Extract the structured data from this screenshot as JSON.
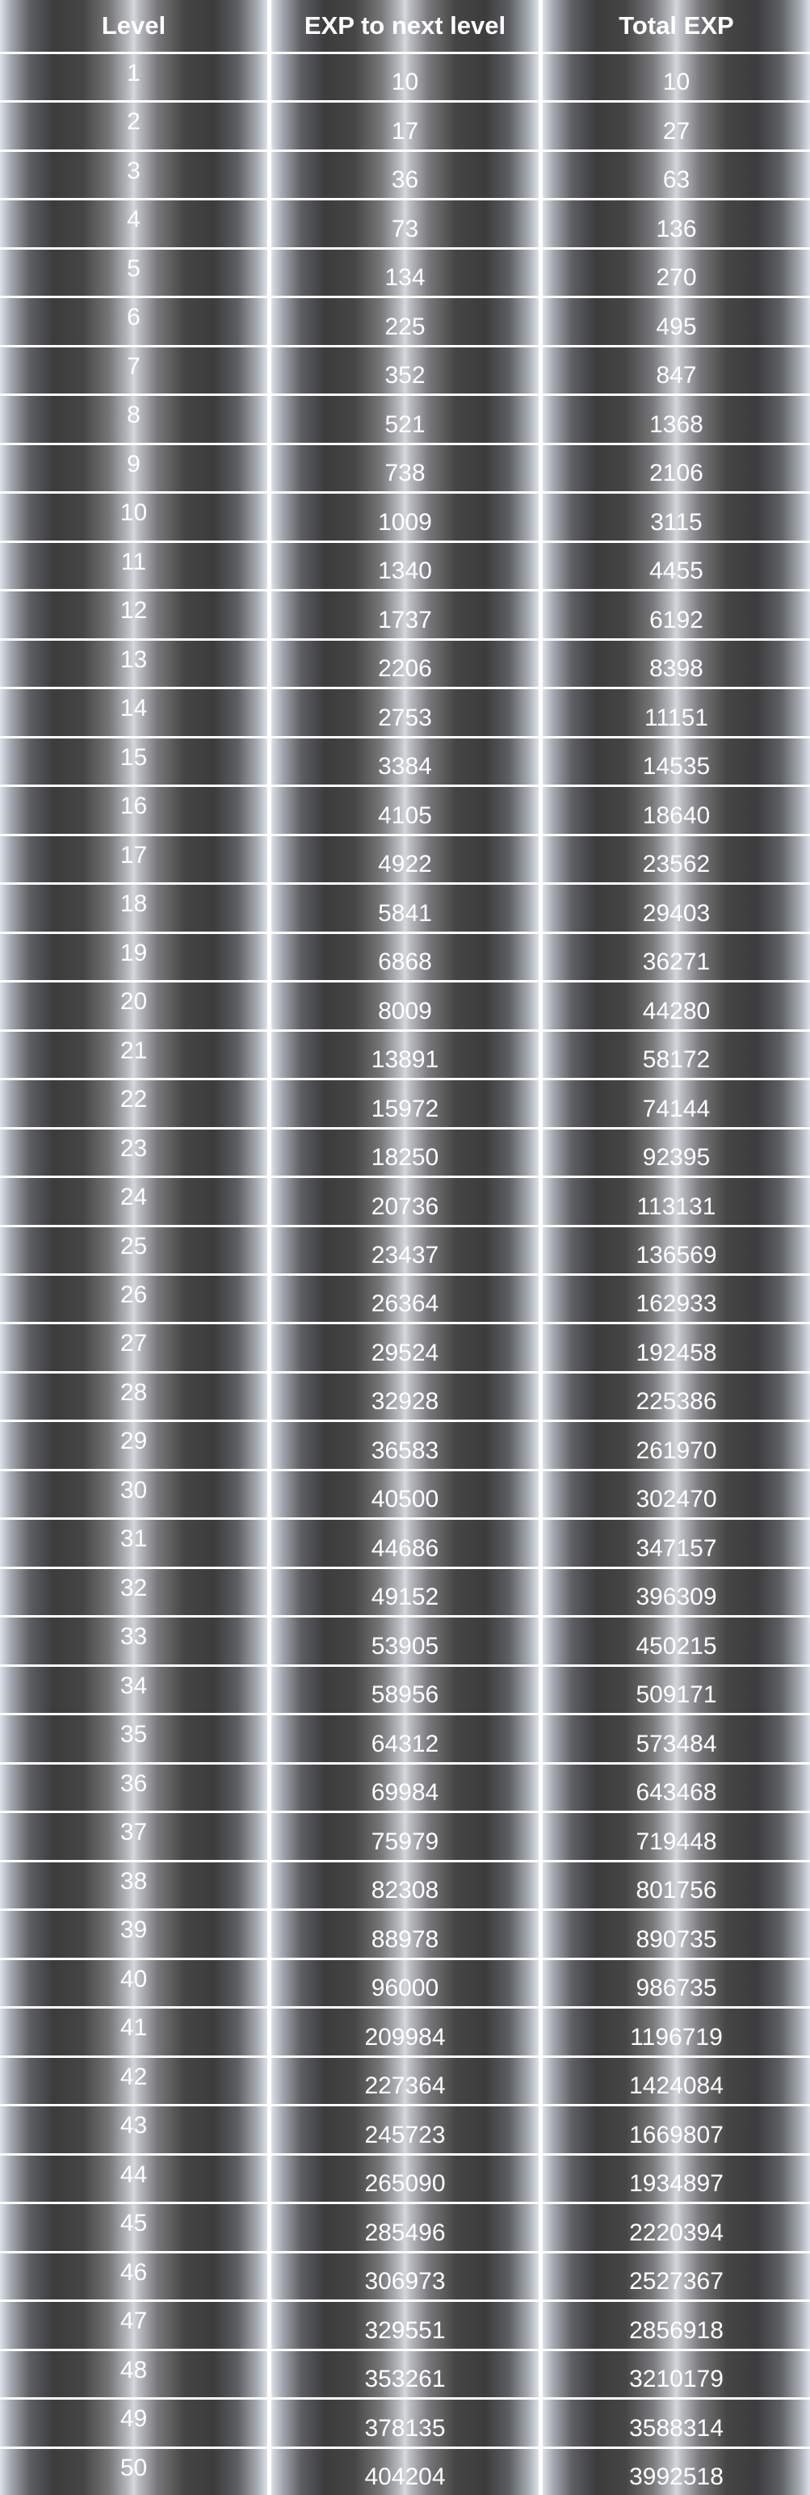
{
  "table": {
    "headers": [
      "Level",
      "EXP to next level",
      "Total EXP"
    ],
    "rows": [
      {
        "level": "1",
        "exp_to_next": "10",
        "total_exp": "10"
      },
      {
        "level": "2",
        "exp_to_next": "17",
        "total_exp": "27"
      },
      {
        "level": "3",
        "exp_to_next": "36",
        "total_exp": "63"
      },
      {
        "level": "4",
        "exp_to_next": "73",
        "total_exp": "136"
      },
      {
        "level": "5",
        "exp_to_next": "134",
        "total_exp": "270"
      },
      {
        "level": "6",
        "exp_to_next": "225",
        "total_exp": "495"
      },
      {
        "level": "7",
        "exp_to_next": "352",
        "total_exp": "847"
      },
      {
        "level": "8",
        "exp_to_next": "521",
        "total_exp": "1368"
      },
      {
        "level": "9",
        "exp_to_next": "738",
        "total_exp": "2106"
      },
      {
        "level": "10",
        "exp_to_next": "1009",
        "total_exp": "3115"
      },
      {
        "level": "11",
        "exp_to_next": "1340",
        "total_exp": "4455"
      },
      {
        "level": "12",
        "exp_to_next": "1737",
        "total_exp": "6192"
      },
      {
        "level": "13",
        "exp_to_next": "2206",
        "total_exp": "8398"
      },
      {
        "level": "14",
        "exp_to_next": "2753",
        "total_exp": "11151"
      },
      {
        "level": "15",
        "exp_to_next": "3384",
        "total_exp": "14535"
      },
      {
        "level": "16",
        "exp_to_next": "4105",
        "total_exp": "18640"
      },
      {
        "level": "17",
        "exp_to_next": "4922",
        "total_exp": "23562"
      },
      {
        "level": "18",
        "exp_to_next": "5841",
        "total_exp": "29403"
      },
      {
        "level": "19",
        "exp_to_next": "6868",
        "total_exp": "36271"
      },
      {
        "level": "20",
        "exp_to_next": "8009",
        "total_exp": "44280"
      },
      {
        "level": "21",
        "exp_to_next": "13891",
        "total_exp": "58172"
      },
      {
        "level": "22",
        "exp_to_next": "15972",
        "total_exp": "74144"
      },
      {
        "level": "23",
        "exp_to_next": "18250",
        "total_exp": "92395"
      },
      {
        "level": "24",
        "exp_to_next": "20736",
        "total_exp": "113131"
      },
      {
        "level": "25",
        "exp_to_next": "23437",
        "total_exp": "136569"
      },
      {
        "level": "26",
        "exp_to_next": "26364",
        "total_exp": "162933"
      },
      {
        "level": "27",
        "exp_to_next": "29524",
        "total_exp": "192458"
      },
      {
        "level": "28",
        "exp_to_next": "32928",
        "total_exp": "225386"
      },
      {
        "level": "29",
        "exp_to_next": "36583",
        "total_exp": "261970"
      },
      {
        "level": "30",
        "exp_to_next": "40500",
        "total_exp": "302470"
      },
      {
        "level": "31",
        "exp_to_next": "44686",
        "total_exp": "347157"
      },
      {
        "level": "32",
        "exp_to_next": "49152",
        "total_exp": "396309"
      },
      {
        "level": "33",
        "exp_to_next": "53905",
        "total_exp": "450215"
      },
      {
        "level": "34",
        "exp_to_next": "58956",
        "total_exp": "509171"
      },
      {
        "level": "35",
        "exp_to_next": "64312",
        "total_exp": "573484"
      },
      {
        "level": "36",
        "exp_to_next": "69984",
        "total_exp": "643468"
      },
      {
        "level": "37",
        "exp_to_next": "75979",
        "total_exp": "719448"
      },
      {
        "level": "38",
        "exp_to_next": "82308",
        "total_exp": "801756"
      },
      {
        "level": "39",
        "exp_to_next": "88978",
        "total_exp": "890735"
      },
      {
        "level": "40",
        "exp_to_next": "96000",
        "total_exp": "986735"
      },
      {
        "level": "41",
        "exp_to_next": "209984",
        "total_exp": "1196719"
      },
      {
        "level": "42",
        "exp_to_next": "227364",
        "total_exp": "1424084"
      },
      {
        "level": "43",
        "exp_to_next": "245723",
        "total_exp": "1669807"
      },
      {
        "level": "44",
        "exp_to_next": "265090",
        "total_exp": "1934897"
      },
      {
        "level": "45",
        "exp_to_next": "285496",
        "total_exp": "2220394"
      },
      {
        "level": "46",
        "exp_to_next": "306973",
        "total_exp": "2527367"
      },
      {
        "level": "47",
        "exp_to_next": "329551",
        "total_exp": "2856918"
      },
      {
        "level": "48",
        "exp_to_next": "353261",
        "total_exp": "3210179"
      },
      {
        "level": "49",
        "exp_to_next": "378135",
        "total_exp": "3588314"
      },
      {
        "level": "50",
        "exp_to_next": "404204",
        "total_exp": "3992518"
      }
    ]
  },
  "colors": {
    "text": "#ffffff",
    "cell_dark": "#3c3c3d",
    "cell_light": "#dde2ea",
    "divider": "#ffffff"
  }
}
